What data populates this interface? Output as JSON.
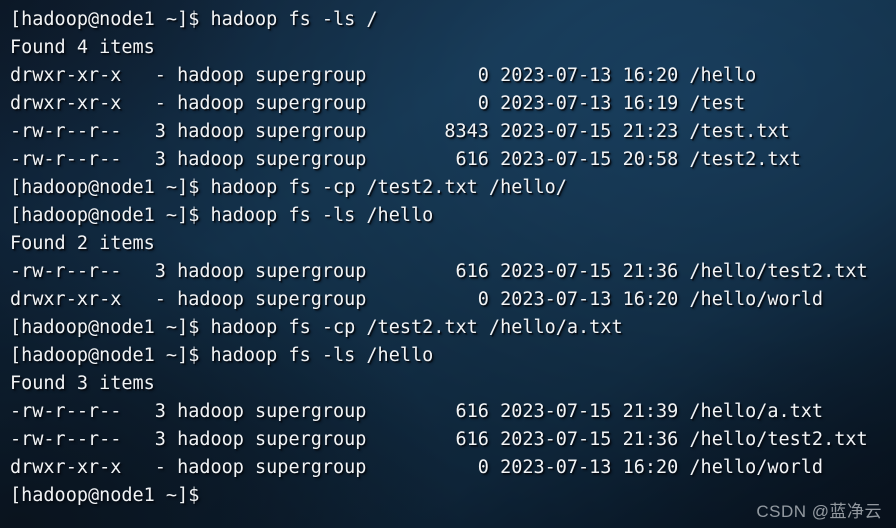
{
  "terminal": {
    "prompt": "[hadoop@node1 ~]$",
    "host": "node1",
    "user": "hadoop",
    "cwd": "~",
    "colors": {
      "text": "#f2f4f6",
      "background_top_right": "#3f6782",
      "background_bottom_left": "#14202c",
      "watermark": "#e7ebef"
    },
    "lines": [
      "[hadoop@node1 ~]$ hadoop fs -ls /",
      "Found 4 items",
      "drwxr-xr-x   - hadoop supergroup          0 2023-07-13 16:20 /hello",
      "drwxr-xr-x   - hadoop supergroup          0 2023-07-13 16:19 /test",
      "-rw-r--r--   3 hadoop supergroup       8343 2023-07-15 21:23 /test.txt",
      "-rw-r--r--   3 hadoop supergroup        616 2023-07-15 20:58 /test2.txt",
      "[hadoop@node1 ~]$ hadoop fs -cp /test2.txt /hello/",
      "[hadoop@node1 ~]$ hadoop fs -ls /hello",
      "Found 2 items",
      "-rw-r--r--   3 hadoop supergroup        616 2023-07-15 21:36 /hello/test2.txt",
      "drwxr-xr-x   - hadoop supergroup          0 2023-07-13 16:20 /hello/world",
      "[hadoop@node1 ~]$ hadoop fs -cp /test2.txt /hello/a.txt",
      "[hadoop@node1 ~]$ hadoop fs -ls /hello",
      "Found 3 items",
      "-rw-r--r--   3 hadoop supergroup        616 2023-07-15 21:39 /hello/a.txt",
      "-rw-r--r--   3 hadoop supergroup        616 2023-07-15 21:36 /hello/test2.txt",
      "drwxr-xr-x   - hadoop supergroup          0 2023-07-13 16:20 /hello/world",
      "[hadoop@node1 ~]$"
    ],
    "commands": [
      "hadoop fs -ls /",
      "hadoop fs -cp /test2.txt /hello/",
      "hadoop fs -ls /hello",
      "hadoop fs -cp /test2.txt /hello/a.txt",
      "hadoop fs -ls /hello"
    ],
    "listings": [
      {
        "header": "Found 4 items",
        "path": "/",
        "entries": [
          {
            "permissions": "drwxr-xr-x",
            "replication": "-",
            "owner": "hadoop",
            "group": "supergroup",
            "size": "0",
            "date": "2023-07-13",
            "time": "16:20",
            "path": "/hello"
          },
          {
            "permissions": "drwxr-xr-x",
            "replication": "-",
            "owner": "hadoop",
            "group": "supergroup",
            "size": "0",
            "date": "2023-07-13",
            "time": "16:19",
            "path": "/test"
          },
          {
            "permissions": "-rw-r--r--",
            "replication": "3",
            "owner": "hadoop",
            "group": "supergroup",
            "size": "8343",
            "date": "2023-07-15",
            "time": "21:23",
            "path": "/test.txt"
          },
          {
            "permissions": "-rw-r--r--",
            "replication": "3",
            "owner": "hadoop",
            "group": "supergroup",
            "size": "616",
            "date": "2023-07-15",
            "time": "20:58",
            "path": "/test2.txt"
          }
        ]
      },
      {
        "header": "Found 2 items",
        "path": "/hello",
        "entries": [
          {
            "permissions": "-rw-r--r--",
            "replication": "3",
            "owner": "hadoop",
            "group": "supergroup",
            "size": "616",
            "date": "2023-07-15",
            "time": "21:36",
            "path": "/hello/test2.txt"
          },
          {
            "permissions": "drwxr-xr-x",
            "replication": "-",
            "owner": "hadoop",
            "group": "supergroup",
            "size": "0",
            "date": "2023-07-13",
            "time": "16:20",
            "path": "/hello/world"
          }
        ]
      },
      {
        "header": "Found 3 items",
        "path": "/hello",
        "entries": [
          {
            "permissions": "-rw-r--r--",
            "replication": "3",
            "owner": "hadoop",
            "group": "supergroup",
            "size": "616",
            "date": "2023-07-15",
            "time": "21:39",
            "path": "/hello/a.txt"
          },
          {
            "permissions": "-rw-r--r--",
            "replication": "3",
            "owner": "hadoop",
            "group": "supergroup",
            "size": "616",
            "date": "2023-07-15",
            "time": "21:36",
            "path": "/hello/test2.txt"
          },
          {
            "permissions": "drwxr-xr-x",
            "replication": "-",
            "owner": "hadoop",
            "group": "supergroup",
            "size": "0",
            "date": "2023-07-13",
            "time": "16:20",
            "path": "/hello/world"
          }
        ]
      }
    ]
  },
  "watermark": {
    "label": "CSDN @蓝净云"
  }
}
